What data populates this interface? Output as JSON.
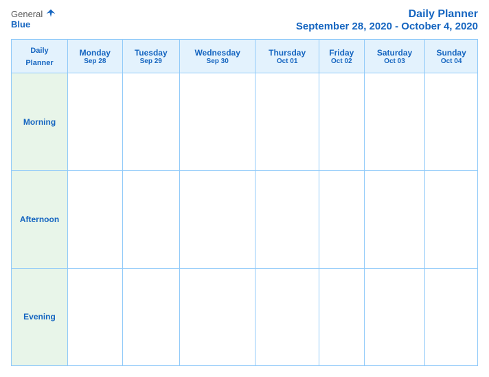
{
  "logo": {
    "general": "General",
    "blue": "Blue"
  },
  "header": {
    "title": "Daily Planner",
    "date_range": "September 28, 2020 - October 4, 2020"
  },
  "table": {
    "column_header_label": "Daily\nPlanner",
    "days": [
      {
        "name": "Monday",
        "date": "Sep 28"
      },
      {
        "name": "Tuesday",
        "date": "Sep 29"
      },
      {
        "name": "Wednesday",
        "date": "Sep 30"
      },
      {
        "name": "Thursday",
        "date": "Oct 01"
      },
      {
        "name": "Friday",
        "date": "Oct 02"
      },
      {
        "name": "Saturday",
        "date": "Oct 03"
      },
      {
        "name": "Sunday",
        "date": "Oct 04"
      }
    ],
    "rows": [
      {
        "label": "Morning"
      },
      {
        "label": "Afternoon"
      },
      {
        "label": "Evening"
      }
    ]
  }
}
